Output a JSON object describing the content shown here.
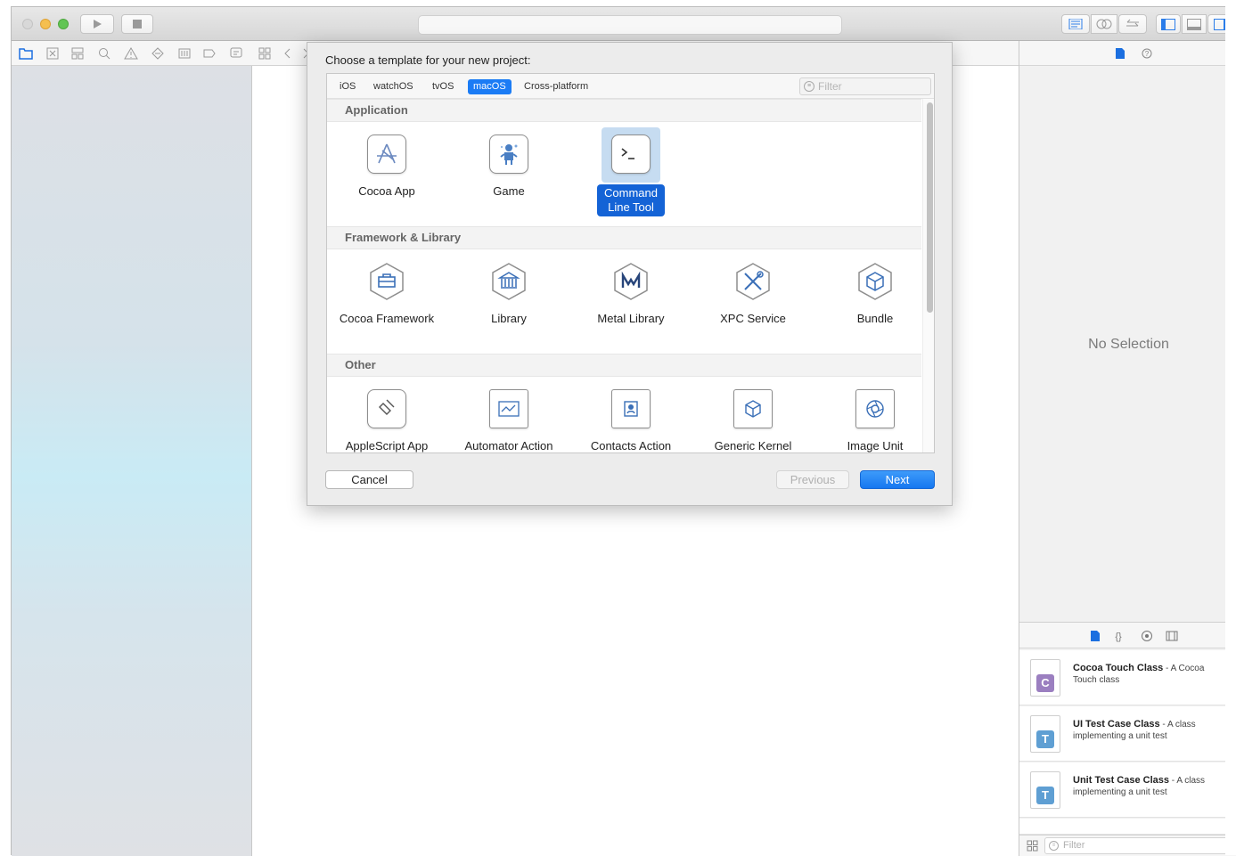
{
  "dialog": {
    "title": "Choose a template for your new project:",
    "platform_tabs": [
      "iOS",
      "watchOS",
      "tvOS",
      "macOS",
      "Cross-platform"
    ],
    "active_tab": "macOS",
    "filter_placeholder": "Filter",
    "sections": [
      {
        "title": "Application",
        "items": [
          "Cocoa App",
          "Game",
          "Command Line Tool"
        ],
        "selected": "Command Line Tool"
      },
      {
        "title": "Framework & Library",
        "items": [
          "Cocoa Framework",
          "Library",
          "Metal Library",
          "XPC Service",
          "Bundle"
        ]
      },
      {
        "title": "Other",
        "items": [
          "AppleScript App",
          "Automator Action",
          "Contacts Action",
          "Generic Kernel",
          "Image Unit"
        ]
      }
    ],
    "selected_label_line1": "Command",
    "selected_label_line2": "Line Tool",
    "cancel_label": "Cancel",
    "previous_label": "Previous",
    "next_label": "Next"
  },
  "inspector": {
    "no_selection": "No Selection"
  },
  "library": {
    "items": [
      {
        "badge": "C",
        "badge_color": "#9b7fc0",
        "name": "Cocoa Touch Class",
        "desc_a": " - A Cocoa",
        "desc_b": "Touch class"
      },
      {
        "badge": "T",
        "badge_color": "#5f9fd3",
        "name": "UI Test Case Class",
        "desc_a": " - A class",
        "desc_b": "implementing a unit test"
      },
      {
        "badge": "T",
        "badge_color": "#5f9fd3",
        "name": "Unit Test Case Class",
        "desc_a": " - A class",
        "desc_b": "implementing a unit test"
      }
    ],
    "filter_placeholder": "Filter"
  },
  "colors": {
    "accent": "#1b7cf5",
    "selection": "#1463d6",
    "traffic_red": "#d9d9d9",
    "traffic_yellow": "#f5bf4f",
    "traffic_green": "#62c554"
  }
}
